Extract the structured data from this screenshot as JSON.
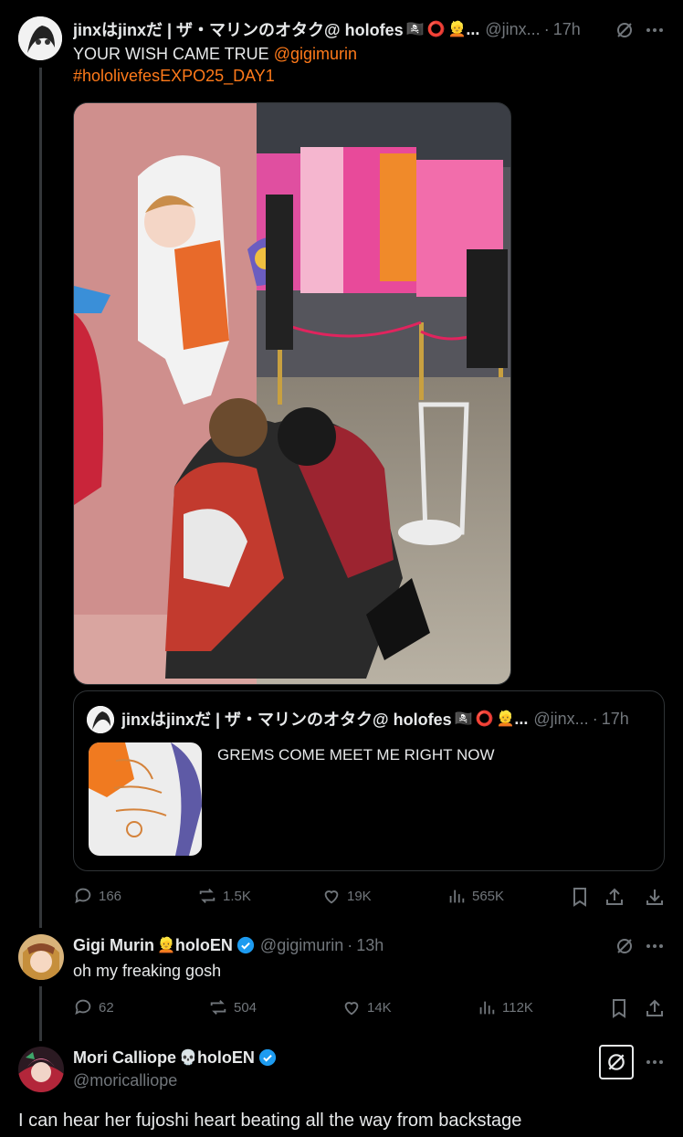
{
  "tweet1": {
    "name": "jinxはjinxだ | ザ・マリンのオタク@ holofes",
    "handle": "@jinx...",
    "time": "17h",
    "text_plain": "YOUR  WISH CAME TRUE ",
    "mention": "@gigimurin",
    "hashtag": "#hololivefesEXPO25_DAY1",
    "stats": {
      "replies": "166",
      "reposts": "1.5K",
      "likes": "19K",
      "views": "565K"
    }
  },
  "quote": {
    "name": "jinxはjinxだ | ザ・マリンのオタク@ holofes",
    "handle": "@jinx...",
    "time": "17h",
    "text": "GREMS COME MEET ME RIGHT NOW"
  },
  "tweet2": {
    "name": "Gigi Murin",
    "name_suffix": "holoEN",
    "handle": "@gigimurin",
    "time": "13h",
    "text": "oh my freaking gosh",
    "stats": {
      "replies": "62",
      "reposts": "504",
      "likes": "14K",
      "views": "112K"
    }
  },
  "tweet3": {
    "name": "Mori Calliope",
    "name_suffix": "holoEN",
    "handle": "@moricalliope",
    "text": "I can hear her fujoshi heart beating all the way from backstage"
  },
  "colors": {
    "accent": "#ff7a1a",
    "verified": "#1d9bf0",
    "muted": "#71767b",
    "border": "#2f3336"
  }
}
